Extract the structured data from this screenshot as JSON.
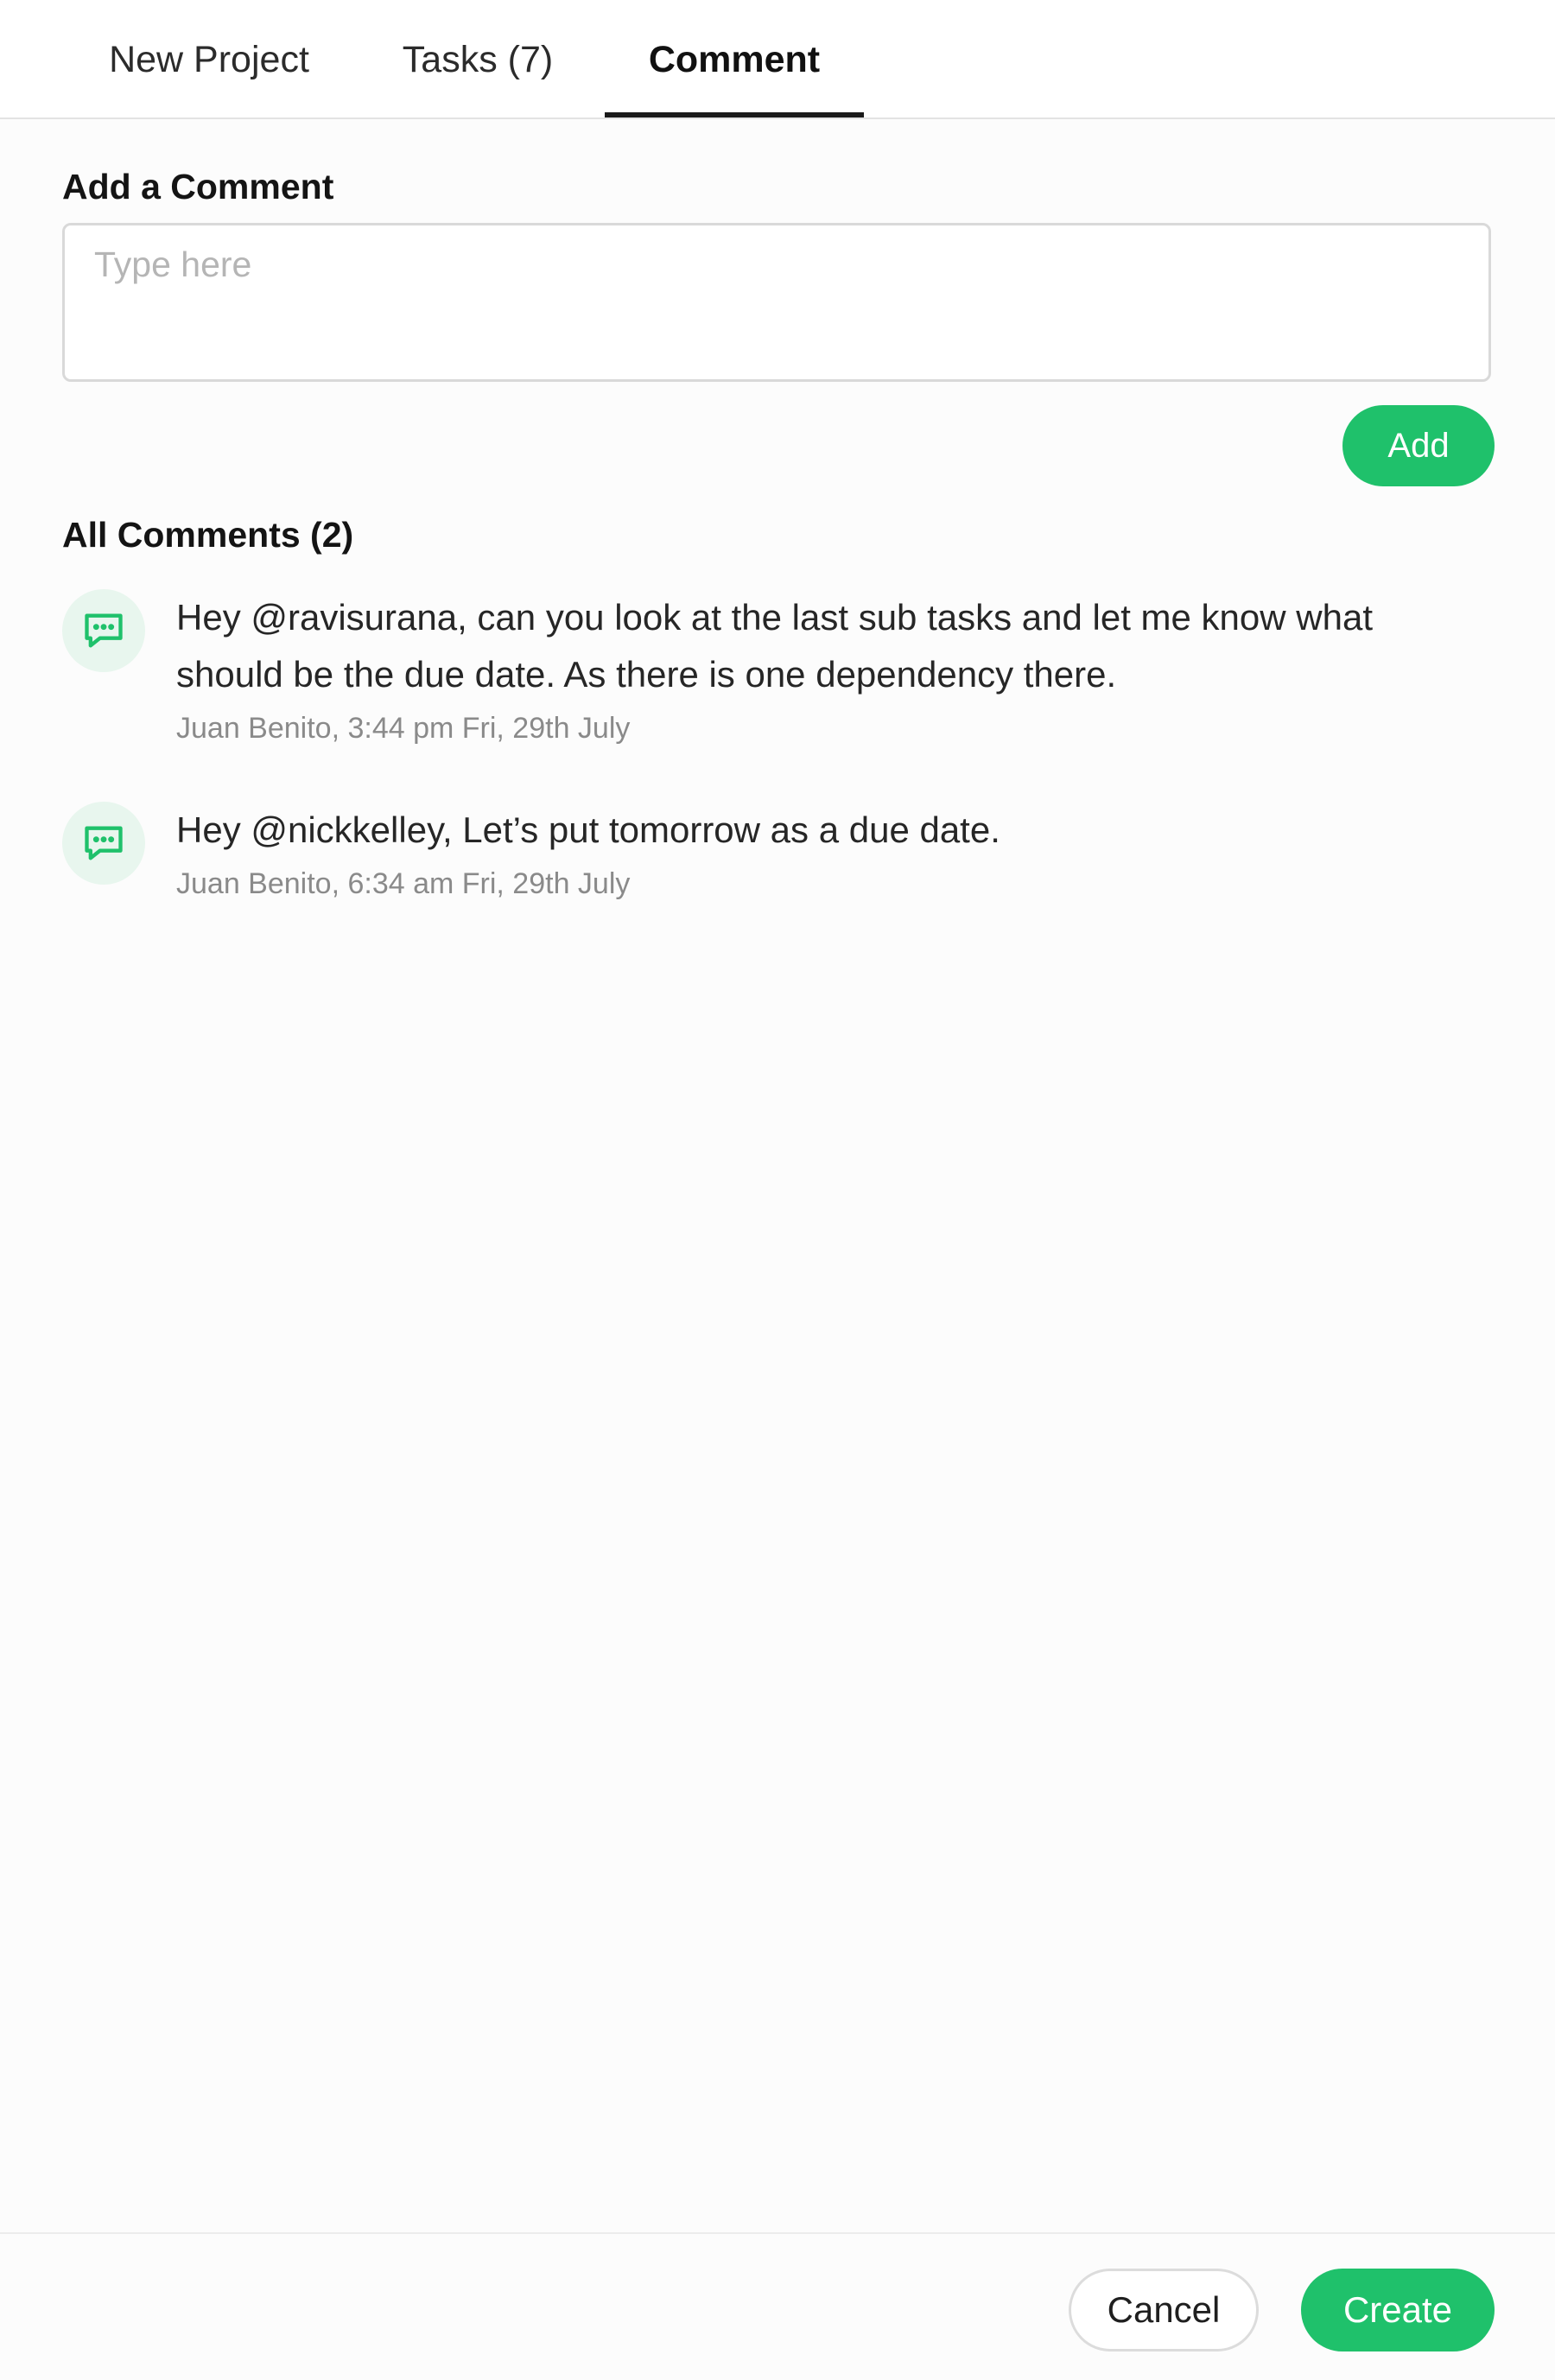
{
  "tabs": [
    {
      "label": "New Project",
      "active": false
    },
    {
      "label": "Tasks (7)",
      "active": false
    },
    {
      "label": "Comment",
      "active": true
    }
  ],
  "add_comment": {
    "title": "Add a Comment",
    "placeholder": "Type here",
    "value": "",
    "add_label": "Add"
  },
  "comments": {
    "title": "All Comments (2)",
    "items": [
      {
        "icon": "comment-bubble-icon",
        "text": "Hey @ravisurana, can you look at the last sub tasks and let me know what should be the due date. As there is one dependency there.",
        "meta": "Juan Benito, 3:44 pm Fri, 29th July"
      },
      {
        "icon": "comment-bubble-icon",
        "text": "Hey @nickkelley, Let’s put tomorrow as a due date.",
        "meta": "Juan Benito, 6:34 am Fri, 29th July"
      }
    ]
  },
  "footer": {
    "cancel_label": "Cancel",
    "create_label": "Create"
  },
  "colors": {
    "accent": "#1fc16b",
    "avatar_bg": "#e8f6ee",
    "text": "#262626",
    "muted": "#8a8a8a"
  }
}
